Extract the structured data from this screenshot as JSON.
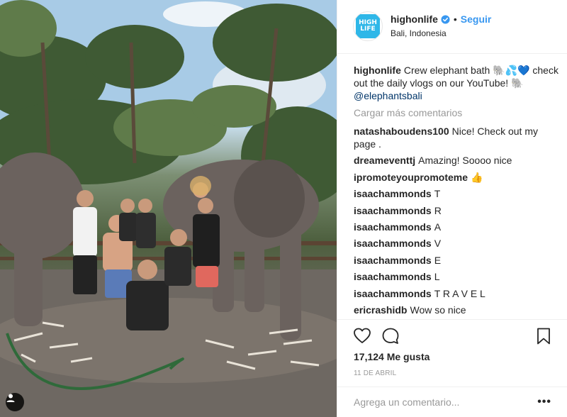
{
  "post": {
    "username": "highonlife",
    "follow_label": "Seguir",
    "separator": "•",
    "location": "Bali, Indonesia",
    "avatar_text": [
      "HIGH",
      "LIFE"
    ],
    "caption_username": "highonlife",
    "caption_text_1": "Crew elephant bath 🐘💦💙 check out the daily vlogs on our YouTube! 🐘",
    "caption_mention": "@elephantsbali",
    "load_more": "Cargar más comentarios",
    "comments": [
      {
        "user": "natashaboudens100",
        "text": "Nice! Check out my page ."
      },
      {
        "user": "dreameventtj",
        "text": "Amazing! Soooo nice"
      },
      {
        "user": "ipromoteyoupromoteme",
        "text": "👍"
      },
      {
        "user": "isaachammonds",
        "text": "T"
      },
      {
        "user": "isaachammonds",
        "text": "R"
      },
      {
        "user": "isaachammonds",
        "text": "A"
      },
      {
        "user": "isaachammonds",
        "text": "V"
      },
      {
        "user": "isaachammonds",
        "text": "E"
      },
      {
        "user": "isaachammonds",
        "text": "L"
      },
      {
        "user": "isaachammonds",
        "text": "T R A V E L"
      },
      {
        "user": "ericrashidb",
        "text": "Wow so nice"
      }
    ],
    "likes": "17,124 Me gusta",
    "date": "11 DE ABRIL",
    "comment_placeholder": "Agrega un comentario...",
    "more_label": "•••"
  },
  "icons": {
    "verified": "verified-badge-icon",
    "like": "heart-icon",
    "comment": "comment-bubble-icon",
    "save": "bookmark-icon",
    "user_tag": "user-tag-icon"
  },
  "colors": {
    "link": "#3897f0",
    "verified": "#3897f0",
    "muted": "#999999",
    "text": "#262626",
    "brand": "#2fb7e8"
  }
}
